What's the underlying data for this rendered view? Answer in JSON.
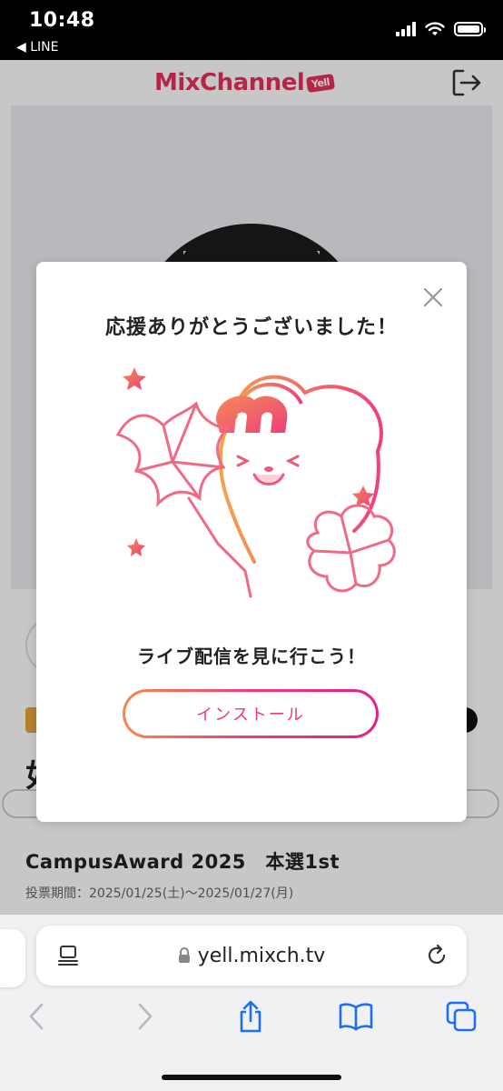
{
  "status_bar": {
    "time": "10:48",
    "back_app": "◀ LINE"
  },
  "site": {
    "logo_text": "MixChannel",
    "logo_badge": "Yell"
  },
  "page": {
    "name_partial": "如",
    "event_title": "CampusAward 2025　本選1st",
    "event_period": "投票期間：2025/01/25(土)〜2025/01/27(月)"
  },
  "modal": {
    "title": "応援ありがとうございました！",
    "subtitle": "ライブ配信を見に行こう！",
    "install_button": "インストール",
    "illustration_letter": "m"
  },
  "browser": {
    "url": "yell.mixch.tv"
  },
  "colors": {
    "accent": "#ee3b6b",
    "gradient_start": "#f7884a",
    "gradient_end": "#e2218a"
  },
  "icons": [
    "back-arrow-icon",
    "signal-icon",
    "wifi-icon",
    "battery-icon",
    "logout-icon",
    "close-icon",
    "reader-icon",
    "lock-icon",
    "reload-icon",
    "back-icon",
    "forward-icon",
    "share-icon",
    "bookmarks-icon",
    "tabs-icon"
  ]
}
